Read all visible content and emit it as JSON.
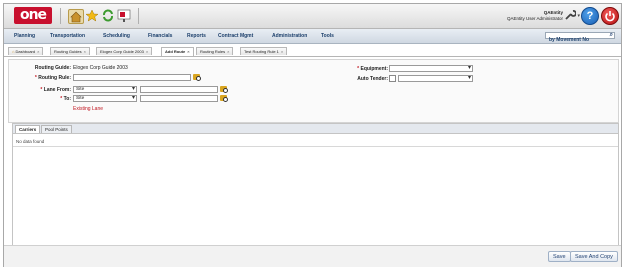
{
  "header": {
    "logo_text": "one",
    "user_name": "QAEntity",
    "user_role": "QAEntity User Administrator"
  },
  "nav": {
    "items": [
      "Planning",
      "Transportation",
      "Scheduling",
      "Financials",
      "Reports",
      "Contract Mgmt",
      "Administration",
      "Tools"
    ],
    "search_placeholder": "by Movement No"
  },
  "tabs": [
    {
      "label": "Dashboard"
    },
    {
      "label": "Routing Guides"
    },
    {
      "label": "Elogex Corp Guide 2003"
    },
    {
      "label": "Add Route",
      "active": true
    },
    {
      "label": "Routing Rules"
    },
    {
      "label": "Test Routing Rule 1"
    }
  ],
  "form": {
    "routing_guide_label": "Routing Guide:",
    "routing_guide_value": "Elogex Corp Guide 2003",
    "routing_rule_label": "Routing Rule:",
    "routing_rule_value": "",
    "lane_from_label": "Lane From:",
    "lane_from_type": "Site",
    "lane_from_value": "",
    "to_label": "To:",
    "to_type": "Site",
    "to_value": "",
    "existing_lane_link": "Existing Lane",
    "equipment_label": "Equipment:",
    "equipment_value": "",
    "auto_tender_label": "Auto Tender:",
    "auto_tender_value": ""
  },
  "grid": {
    "tabs": [
      "Carriers",
      "Pool Points"
    ],
    "empty_text": "No data found"
  },
  "footer": {
    "save_label": "Save",
    "save_copy_label": "Save And Copy"
  },
  "colors": {
    "brand_red": "#c8102e",
    "required_red": "#c0141e",
    "nav_text": "#1c3f6b"
  }
}
